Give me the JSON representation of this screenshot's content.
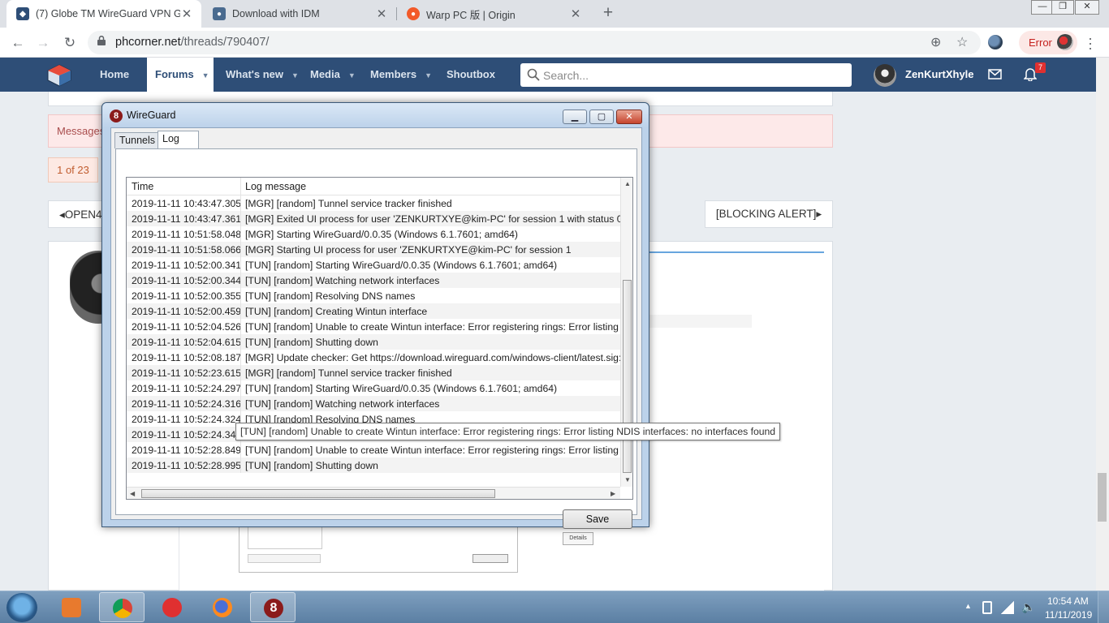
{
  "browser": {
    "tabs": [
      {
        "title": "(7) Globe TM WireGuard VPN Glo",
        "favicon": "phcorner-icon"
      },
      {
        "title": "Download with IDM",
        "favicon": "idm-icon"
      },
      {
        "title": "Warp PC 版 | Origin",
        "favicon": "origin-icon"
      }
    ],
    "url_host": "phcorner.net",
    "url_path": "/threads/790407/",
    "error_label": "Error"
  },
  "site": {
    "nav": [
      {
        "label": "Home"
      },
      {
        "label": "Forums"
      },
      {
        "label": "What's new"
      },
      {
        "label": "Media"
      },
      {
        "label": "Members"
      },
      {
        "label": "Shoutbox"
      }
    ],
    "search_placeholder": "Search...",
    "username": "ZenKurtXhyle",
    "alert_count": "7",
    "message_bar": "Messages",
    "page_indicator": "1 of 23",
    "prev_thread": "OPEN4",
    "next_thread": "[BLOCKING ALERT]",
    "details_label": "Details"
  },
  "wireguard": {
    "title": "WireGuard",
    "tabs": [
      "Tunnels",
      "Log"
    ],
    "columns": {
      "time": "Time",
      "message": "Log message"
    },
    "log": [
      {
        "time": "2019-11-11 10:43:47.305",
        "message": "[MGR] [random] Tunnel service tracker finished"
      },
      {
        "time": "2019-11-11 10:43:47.361",
        "message": "[MGR] Exited UI process for user 'ZENKURTXYE@kim-PC' for session 1 with status 0"
      },
      {
        "time": "2019-11-11 10:51:58.048",
        "message": "[MGR] Starting WireGuard/0.0.35 (Windows 6.1.7601; amd64)"
      },
      {
        "time": "2019-11-11 10:51:58.066",
        "message": "[MGR] Starting UI process for user 'ZENKURTXYE@kim-PC' for session 1"
      },
      {
        "time": "2019-11-11 10:52:00.341",
        "message": "[TUN] [random] Starting WireGuard/0.0.35 (Windows 6.1.7601; amd64)"
      },
      {
        "time": "2019-11-11 10:52:00.344",
        "message": "[TUN] [random] Watching network interfaces"
      },
      {
        "time": "2019-11-11 10:52:00.355",
        "message": "[TUN] [random] Resolving DNS names"
      },
      {
        "time": "2019-11-11 10:52:00.459",
        "message": "[TUN] [random] Creating Wintun interface"
      },
      {
        "time": "2019-11-11 10:52:04.526",
        "message": "[TUN] [random] Unable to create Wintun interface: Error registering rings: Error listing N"
      },
      {
        "time": "2019-11-11 10:52:04.615",
        "message": "[TUN] [random] Shutting down"
      },
      {
        "time": "2019-11-11 10:52:08.187",
        "message": "[MGR] Update checker: Get https://download.wireguard.com/windows-client/latest.sig:"
      },
      {
        "time": "2019-11-11 10:52:23.615",
        "message": "[MGR] [random] Tunnel service tracker finished"
      },
      {
        "time": "2019-11-11 10:52:24.297",
        "message": "[TUN] [random] Starting WireGuard/0.0.35 (Windows 6.1.7601; amd64)"
      },
      {
        "time": "2019-11-11 10:52:24.316",
        "message": "[TUN] [random] Watching network interfaces"
      },
      {
        "time": "2019-11-11 10:52:24.324",
        "message": "[TUN] [random] Resolving DNS names"
      },
      {
        "time": "2019-11-11 10:52:24.344",
        "message": "[TUN] [random] Creating Wintun interface"
      },
      {
        "time": "2019-11-11 10:52:28.849",
        "message": "[TUN] [random] Unable to create Wintun interface: Error registering rings: Error listing NDIS interfaces: no interfaces found"
      },
      {
        "time": "2019-11-11 10:52:28.995",
        "message": "[TUN] [random] Shutting down"
      }
    ],
    "tooltip": "[TUN] [random] Unable to create Wintun interface: Error registering rings: Error listing NDIS interfaces: no interfaces found",
    "save_label": "Save"
  },
  "taskbar": {
    "time": "10:54 AM",
    "date": "11/11/2019"
  }
}
